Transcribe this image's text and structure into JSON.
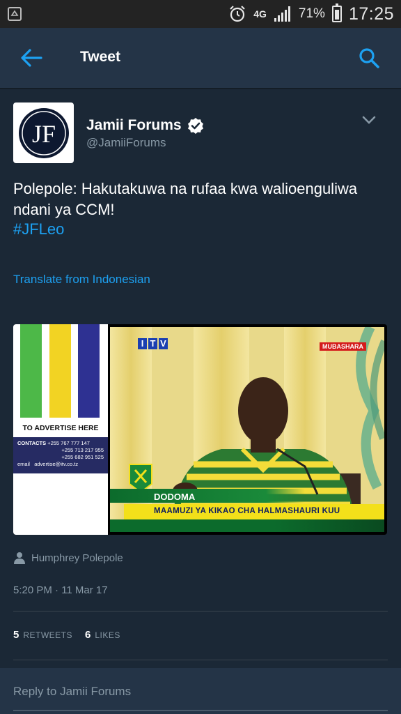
{
  "status_bar": {
    "network": "4G",
    "battery": "71%",
    "time": "17:25"
  },
  "app_bar": {
    "title": "Tweet"
  },
  "tweet": {
    "author_name": "Jamii Forums",
    "author_handle": "@JamiiForums",
    "avatar_text": "JF",
    "text": "Polepole: Hakutakuwa na rufaa kwa walioenguliwa ndani ya CCM!",
    "hashtag": "#JFLeo",
    "translate_label": "Translate from Indonesian",
    "media": {
      "ad_heading": "TO ADVERTISE HERE",
      "ad_contacts_label": "CONTACTS",
      "ad_phone_1": "+255 767 777 147",
      "ad_phone_2": "+255 713 217 955",
      "ad_phone_3": "+255 682 951 525",
      "ad_email_label": "email",
      "ad_email": "advertise@itv.co.tz",
      "channel_logo": [
        "I",
        "T",
        "V"
      ],
      "live_badge": "MUBASHARA",
      "location": "DODOMA",
      "headline": "MAAMUZI YA KIKAO CHA HALMASHAURI KUU"
    },
    "source_person": "Humphrey Polepole",
    "timestamp": "5:20 PM · 11 Mar 17",
    "retweets_count": "5",
    "retweets_label": "RETWEETS",
    "likes_count": "6",
    "likes_label": "LIKES"
  },
  "reply": {
    "placeholder": "Reply to Jamii Forums"
  },
  "colors": {
    "background": "#1b2836",
    "app_bar": "#243447",
    "accent": "#1da1f2",
    "secondary_text": "#8899a6"
  }
}
